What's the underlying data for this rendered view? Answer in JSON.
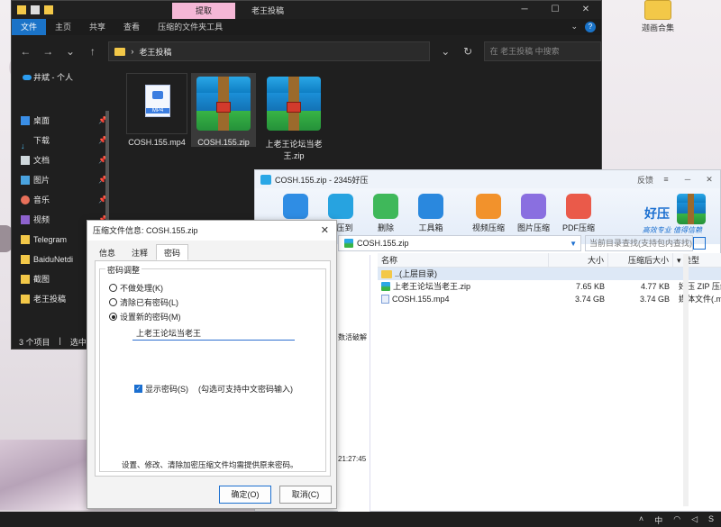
{
  "desktop": {
    "icon_label": "迦画合集"
  },
  "explorer": {
    "context_tab": "提取",
    "title": "老王投稿",
    "ribbon_tabs": [
      "文件",
      "主页",
      "共享",
      "查看",
      "压缩的文件夹工具"
    ],
    "address": "老王投稿",
    "search_placeholder": "在 老王投稿 中搜索",
    "sidebar_header": "井斌 - 个人",
    "sidebar_items": [
      "桌面",
      "下载",
      "文档",
      "图片",
      "音乐",
      "视频",
      "Telegram",
      "BaiduNetdi",
      "截图",
      "老王投稿"
    ],
    "files": [
      {
        "name": "COSH.155.mp4",
        "type": "mp4",
        "type_label": "MP4"
      },
      {
        "name": "COSH.155.zip",
        "type": "zip"
      },
      {
        "name": "上老王论坛当老王.zip",
        "type": "zip"
      }
    ],
    "status_items": "3 个项目",
    "status_selected": "选中 1"
  },
  "haozip": {
    "title": "COSH.155.zip - 2345好压",
    "feedback": "反馈",
    "tools": [
      "添加",
      "解压到",
      "删除",
      "工具箱",
      "视频压缩",
      "图片压缩",
      "PDF压缩"
    ],
    "brand_name": "好压",
    "brand_slogan": "高效专业 值得信赖",
    "path": "COSH.155.zip",
    "search_placeholder": "当前目录查找(支持包内查找)",
    "columns": [
      "名称",
      "大小",
      "压缩后大小",
      "类型"
    ],
    "rows": [
      {
        "name": "..(上层目录)",
        "size": "",
        "packed": "",
        "type": ""
      },
      {
        "name": "上老王论坛当老王.zip",
        "size": "7.65 KB",
        "packed": "4.77 KB",
        "type": "好压 ZIP 压缩"
      },
      {
        "name": "COSH.155.mp4",
        "size": "3.74 GB",
        "packed": "3.74 GB",
        "type": "媒体文件(.mp"
      }
    ],
    "left_text": "数活破解",
    "left_time": "21:27:45"
  },
  "dialog": {
    "title": "压缩文件信息: COSH.155.zip",
    "tabs": [
      "信息",
      "注释",
      "密码"
    ],
    "group_label": "密码调整",
    "options": [
      "不做处理(K)",
      "清除已有密码(L)",
      "设置新的密码(M)"
    ],
    "password_value": "上老王论坛当老王",
    "show_password": "显示密码(S)",
    "hint": "(勾选可支持中文密码输入)",
    "note": "设置、修改、清除加密压缩文件均需提供原来密码。",
    "ok": "确定(O)",
    "cancel": "取消(C)"
  },
  "taskbar": {
    "ime": "中",
    "lang": "S"
  }
}
